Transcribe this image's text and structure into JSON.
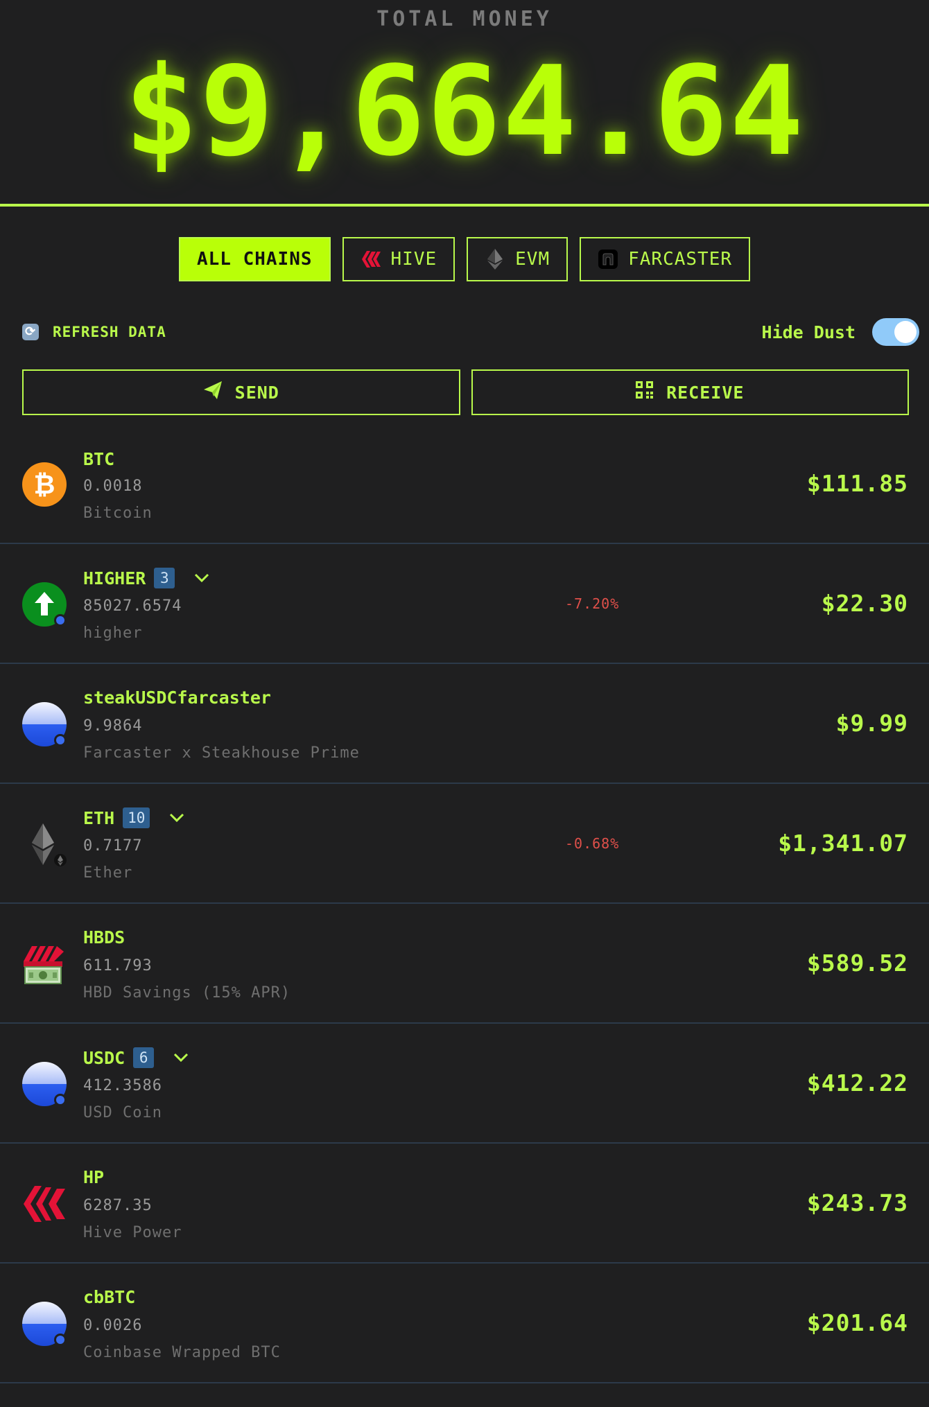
{
  "header": {
    "label": "TOTAL MONEY",
    "amount": "$9,664.64"
  },
  "chain_tabs": [
    {
      "label": "ALL CHAINS",
      "active": true,
      "icon": ""
    },
    {
      "label": "HIVE",
      "active": false,
      "icon": "hive-icon"
    },
    {
      "label": "EVM",
      "active": false,
      "icon": "ethereum-icon"
    },
    {
      "label": "FARCASTER",
      "active": false,
      "icon": "farcaster-icon"
    }
  ],
  "controls": {
    "refresh_label": "REFRESH DATA",
    "hide_dust_label": "Hide Dust",
    "hide_dust_on": true
  },
  "actions": {
    "send_label": "SEND",
    "receive_label": "RECEIVE"
  },
  "assets": [
    {
      "symbol": "BTC",
      "amount": "0.0018",
      "name": "Bitcoin",
      "value": "$111.85",
      "change": "",
      "count": "",
      "icon": "bitcoin-icon"
    },
    {
      "symbol": "HIGHER",
      "amount": "85027.6574",
      "name": "higher",
      "value": "$22.30",
      "change": "-7.20%",
      "count": "3",
      "icon": "higher-icon"
    },
    {
      "symbol": "steakUSDCfarcaster",
      "amount": "9.9864",
      "name": "Farcaster x Steakhouse Prime",
      "value": "$9.99",
      "change": "",
      "count": "",
      "icon": "base-token-icon"
    },
    {
      "symbol": "ETH",
      "amount": "0.7177",
      "name": "Ether",
      "value": "$1,341.07",
      "change": "-0.68%",
      "count": "10",
      "icon": "ethereum-icon"
    },
    {
      "symbol": "HBDS",
      "amount": "611.793",
      "name": "HBD Savings (15% APR)",
      "value": "$589.52",
      "change": "",
      "count": "",
      "icon": "hbd-savings-icon"
    },
    {
      "symbol": "USDC",
      "amount": "412.3586",
      "name": "USD Coin",
      "value": "$412.22",
      "change": "",
      "count": "6",
      "icon": "base-token-icon"
    },
    {
      "symbol": "HP",
      "amount": "6287.35",
      "name": "Hive Power",
      "value": "$243.73",
      "change": "",
      "count": "",
      "icon": "hive-icon"
    },
    {
      "symbol": "cbBTC",
      "amount": "0.0026",
      "name": "Coinbase Wrapped BTC",
      "value": "$201.64",
      "change": "",
      "count": "",
      "icon": "base-token-icon"
    }
  ],
  "colors": {
    "accent": "#b9ff08",
    "text_green": "#b9f94b",
    "background": "#1f1f20",
    "negative": "#e0504a",
    "badge": "#2e5f8f"
  }
}
